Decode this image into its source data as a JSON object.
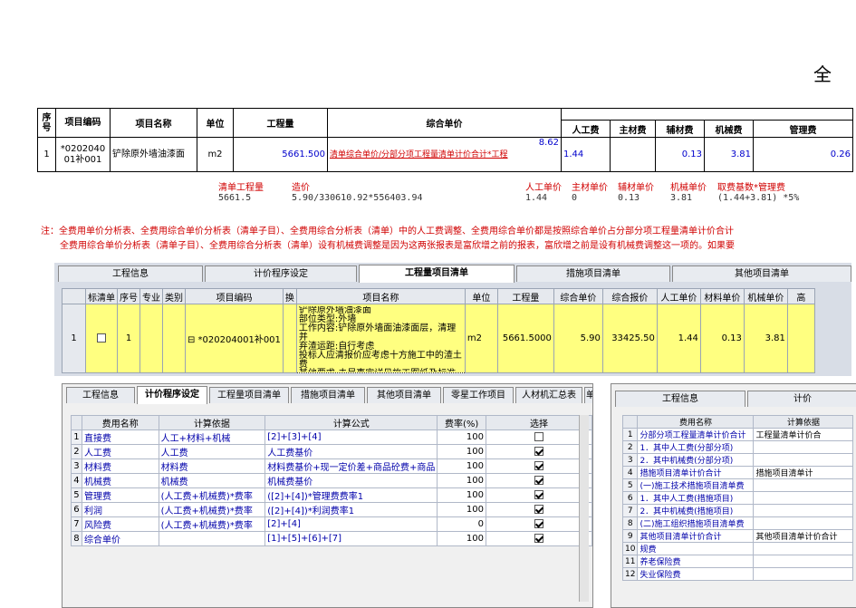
{
  "doc": {
    "big_char": "全",
    "table": {
      "headers": {
        "seq": "序号",
        "code": "项目编码",
        "name": "项目名称",
        "unit": "单位",
        "qty": "工程量",
        "composite": "综合单价"
      },
      "sub_headers": [
        "人工费",
        "主材费",
        "辅材费",
        "机械费",
        "管理费"
      ],
      "row": {
        "seq": "1",
        "code": "*020204001补001",
        "name": "铲除原外墙油漆面",
        "unit": "m2",
        "qty": "5661.500",
        "composite": "8.62",
        "composite_note": "清单综合单价/分部分项工程量清单计价合计*工程",
        "labor": "1.44",
        "main_mat": "",
        "aux_mat": "0.13",
        "machine": "3.81",
        "mgmt": "0.26"
      }
    },
    "calc_labels": {
      "qty_label": "清单工程量",
      "price_label": "造价",
      "labor": "人工单价",
      "main": "主材单价",
      "aux": "辅材单价",
      "machine": "机械单价",
      "mgmt": "取费基数*管理费"
    },
    "calc_values": {
      "qty": "5661.5",
      "price": "5.90/330610.92*556403.94",
      "labor": "1.44",
      "main": "0",
      "aux": "0.13",
      "machine": "3.81",
      "mgmt": "(1.44+3.81) *5%"
    },
    "note_line1": "注：全费用单价分析表、全费用综合单价分析表（清单子目）、全费用综合分析表（清单）中的人工费调整、全费用综合单价都是按照综合单价占分部分项工程量清单计价合计",
    "note_line2": "全费用综合单价分析表（清单子目）、全费用综合分析表（清单）设有机械费调整是因为这两张报表是富欣增之前的报表，富欣增之前是设有机械费调整这一项的。如果要"
  },
  "panel1": {
    "tabs": [
      "工程信息",
      "计价程序设定",
      "工程量项目清单",
      "措施项目清单",
      "其他项目清单"
    ],
    "headers": [
      "标清单",
      "序号",
      "专业",
      "类别",
      "项目编码",
      "换",
      "项目名称",
      "单位",
      "工程量",
      "综合单价",
      "综合报价",
      "人工单价",
      "材料单价",
      "机械单价",
      "高"
    ],
    "row": {
      "num": "1",
      "seq": "1",
      "code": "⊟ *020204001补001",
      "desc": "铲除原外墙油漆面\n部位类型:外墙\n工作内容:铲除原外墙面油漆面层，清理并\n弃渣运距:自行考虑\n投标人应清报价应考虑十方施工中的渣土费\n其他要求:未尽事宜详见施工图纸及标准规",
      "unit": "m2",
      "qty": "5661.5000",
      "composite": "5.90",
      "total": "33425.50",
      "labor": "1.44",
      "material": "0.13",
      "machine": "3.81"
    }
  },
  "panel2": {
    "tabs": [
      "工程信息",
      "计价程序设定",
      "工程量项目清单",
      "措施项目清单",
      "其他项目清单",
      "零星工作项目",
      "人材机汇总表",
      "单"
    ],
    "headers": [
      "",
      "费用名称",
      "计算依据",
      "计算公式",
      "费率(%)",
      "选择"
    ],
    "rows": [
      {
        "n": "1",
        "name": "直接费",
        "basis": "人工+材料+机械",
        "formula": "[2]+[3]+[4]",
        "rate": "100",
        "checked": false
      },
      {
        "n": "2",
        "name": "人工费",
        "basis": "人工费",
        "formula": "人工费基价",
        "rate": "100",
        "checked": true
      },
      {
        "n": "3",
        "name": "材料费",
        "basis": "材料费",
        "formula": "材料费基价+现一定价差+商品砼费+商品",
        "rate": "100",
        "checked": true
      },
      {
        "n": "4",
        "name": "机械费",
        "basis": "机械费",
        "formula": "机械费基价",
        "rate": "100",
        "checked": true
      },
      {
        "n": "5",
        "name": "管理费",
        "basis": "(人工费+机械费)*费率",
        "formula": "([2]+[4])*管理费费率1",
        "rate": "100",
        "checked": true
      },
      {
        "n": "6",
        "name": "利润",
        "basis": "(人工费+机械费)*费率",
        "formula": "([2]+[4])*利润费率1",
        "rate": "100",
        "checked": true
      },
      {
        "n": "7",
        "name": "风险费",
        "basis": "(人工费+机械费)*费率",
        "formula": "[2]+[4]",
        "rate": "0",
        "checked": true
      },
      {
        "n": "8",
        "name": "综合单价",
        "basis": "",
        "formula": "[1]+[5]+[6]+[7]",
        "rate": "100",
        "checked": true
      }
    ]
  },
  "panel3": {
    "tabs": [
      "工程信息",
      "计价"
    ],
    "headers": [
      "",
      "费用名称",
      "计算依据"
    ],
    "rows": [
      {
        "n": "1",
        "name": "分部分项工程量清单计价合计",
        "basis": "工程量清单计价合"
      },
      {
        "n": "2",
        "name": "1．其中人工费(分部分项)",
        "basis": ""
      },
      {
        "n": "3",
        "name": "2．其中机械费(分部分项)",
        "basis": ""
      },
      {
        "n": "4",
        "name": "措施项目清单计价合计",
        "basis": "措施项目清单计"
      },
      {
        "n": "5",
        "name": "(一)施工技术措施项目清单费",
        "basis": ""
      },
      {
        "n": "6",
        "name": "1．其中人工费(措施项目)",
        "basis": ""
      },
      {
        "n": "7",
        "name": "2．其中机械费(措施项目)",
        "basis": ""
      },
      {
        "n": "8",
        "name": "(二)施工组织措施项目清单费",
        "basis": ""
      },
      {
        "n": "9",
        "name": "其他项目清单计价合计",
        "basis": "其他项目清单计价合计"
      },
      {
        "n": "10",
        "name": "规费",
        "basis": ""
      },
      {
        "n": "11",
        "name": "养老保险费",
        "basis": ""
      },
      {
        "n": "12",
        "name": "失业保险费",
        "basis": ""
      }
    ]
  }
}
